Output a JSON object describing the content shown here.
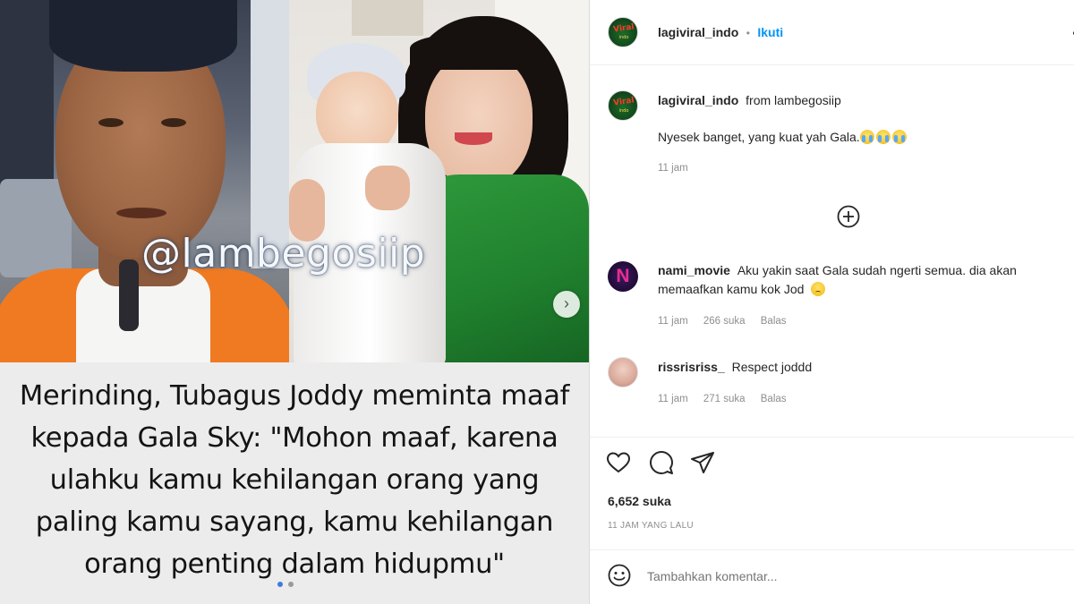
{
  "media": {
    "watermark": "@lambegosiip",
    "caption_lines": [
      "Merinding, Tubagus Joddy meminta maaf",
      "kepada Gala Sky: \"Mohon maaf, karena",
      "ulahku kamu kehilangan orang yang",
      "paling kamu sayang, kamu kehilangan",
      "orang penting dalam hidupmu\""
    ],
    "next_icon": "chevron-right-icon"
  },
  "header": {
    "username": "lagiviral_indo",
    "separator": "•",
    "follow_label": "Ikuti",
    "more_icon": "more-icon"
  },
  "caption": {
    "username": "lagiviral_indo",
    "from_text": "from lambegosiip",
    "text": "Nyesek banget, yang kuat yah Gala.",
    "time": "11 jam"
  },
  "load_more_icon": "plus-circle-icon",
  "comments": [
    {
      "username": "nami_movie",
      "text_line1": "Aku yakin saat Gala sudah ngerti semua. dia akan",
      "text_line2": "memaafkan kamu kok Jod",
      "time": "11 jam",
      "likes": "266 suka",
      "reply": "Balas",
      "avatar_letter": "N"
    },
    {
      "username": "rissrisriss_",
      "text_line1": "Respect joddd",
      "time": "11 jam",
      "likes": "271 suka",
      "reply": "Balas"
    }
  ],
  "actions": {
    "like_icon": "heart-icon",
    "comment_icon": "comment-icon",
    "share_icon": "send-icon",
    "likes_count": "6,652 suka",
    "posted_ago": "11 JAM YANG LALU"
  },
  "add_comment": {
    "emoji_icon": "smiley-icon",
    "placeholder": "Tambahkan komentar..."
  }
}
